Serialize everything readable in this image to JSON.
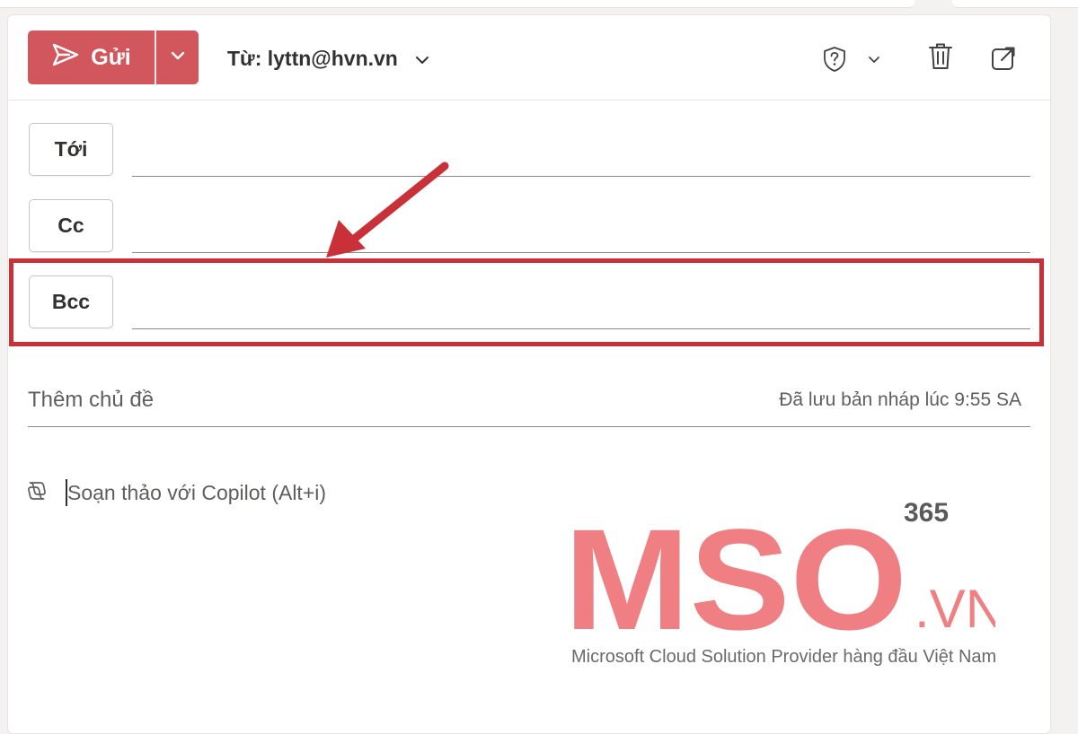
{
  "toolbar": {
    "send_label": "Gửi",
    "from_label": "Từ: lyttn@hvn.vn"
  },
  "recipients": {
    "to_label": "Tới",
    "cc_label": "Cc",
    "bcc_label": "Bcc"
  },
  "subject": {
    "placeholder": "Thêm chủ đề",
    "draft_status": "Đã lưu bản nháp lúc 9:55 SA"
  },
  "body": {
    "copilot_prompt": "Soạn thảo với Copilot (Alt+i)"
  },
  "watermark": {
    "brand": "MSO",
    "suffix": ".VN",
    "superscript": "365",
    "tagline": "Microsoft Cloud Solution Provider hàng đầu Việt Nam"
  },
  "colors": {
    "send_button": "#d2575d",
    "highlight": "#c93038",
    "watermark": "#ef7f82"
  },
  "icons": {
    "send": "paper-plane-icon",
    "sensitivity": "shield-question-icon",
    "discard": "trash-icon",
    "popout": "pop-out-icon",
    "copilot": "copilot-icon"
  }
}
